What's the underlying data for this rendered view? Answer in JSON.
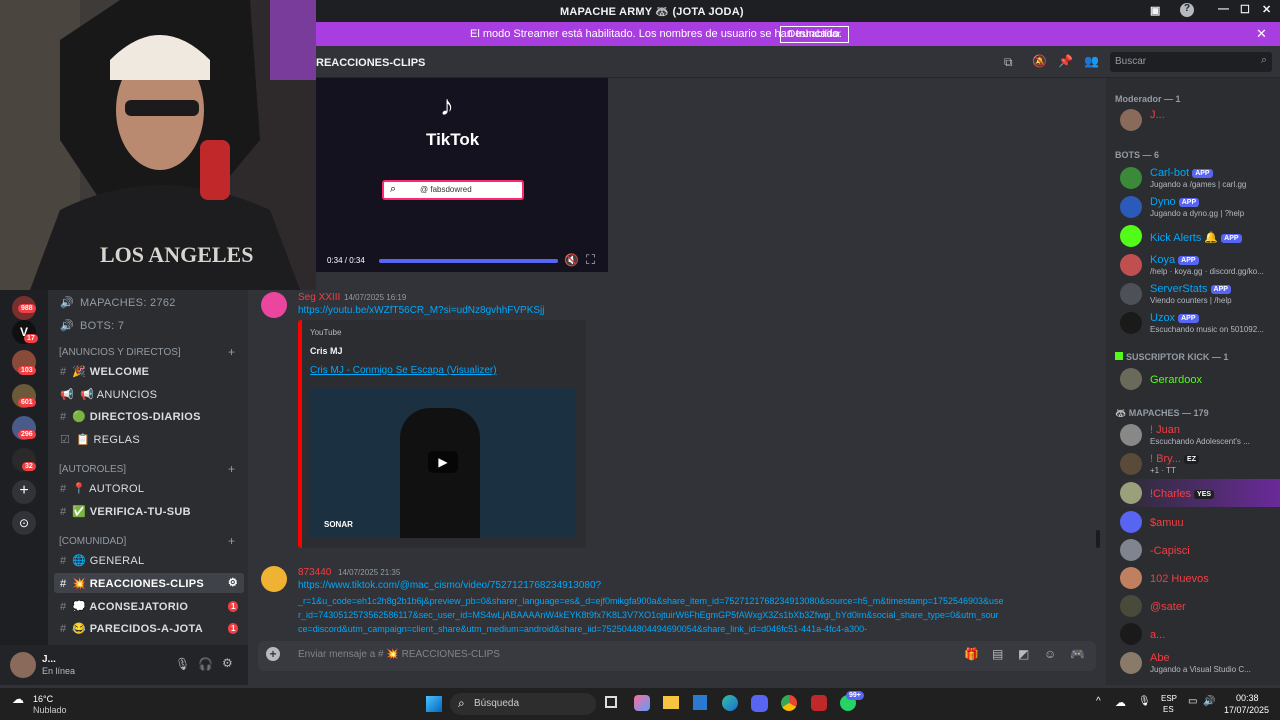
{
  "window": {
    "title": "MAPACHE ARMY 🦝 (JOTA JODA)"
  },
  "streamer_banner": {
    "message": "El modo Streamer está habilitado. Los nombres de usuario se han truncado.",
    "disable_label": "Deshabilitar"
  },
  "channel_header": {
    "name": "REACCIONES-CLIPS",
    "search_placeholder": "Buscar"
  },
  "tiktok_video": {
    "brand": "TikTok",
    "handle": "@ fabsdowred",
    "time": "0:34 / 0:34",
    "progress": 1.0
  },
  "server_rail": {
    "badges": [
      "988",
      "17",
      "103",
      "601",
      "296",
      "32"
    ]
  },
  "channels": {
    "stats": [
      "MAPACHES: 2762",
      "BOTS: 7"
    ],
    "categories": [
      "[ANUNCIOS Y DIRECTOS]",
      "[AUTOROLES]",
      "[COMUNIDAD]"
    ],
    "items": [
      {
        "label": "🎉 WELCOME"
      },
      {
        "label": "📢 ANUNCIOS"
      },
      {
        "label": "🟢 DIRECTOS-DIARIOS"
      },
      {
        "label": "📋 REGLAS"
      },
      {
        "label": "📍 AUTOROL"
      },
      {
        "label": "✅ VERIFICA-TU-SUB"
      },
      {
        "label": "🌐 GENERAL"
      },
      {
        "label": "💥 REACCIONES-CLIPS"
      },
      {
        "label": "💭 ACONSEJATORIO",
        "badge": "1"
      },
      {
        "label": "😂 PARECIDOS-A-JOTA",
        "badge": "1"
      }
    ]
  },
  "user_panel": {
    "name": "J...",
    "status": "En línea"
  },
  "messages": [
    {
      "author": "Seg XXIII",
      "time": "14/07/2025 16:19",
      "link": "https://youtu.be/xWZfT56CR_M?si=udNz8gvhhFVPKSjj",
      "embed": {
        "provider": "YouTube",
        "author": "Cris MJ",
        "title": "Cris MJ - Conmigo Se Escapa (Visualizer)",
        "thumb_label": "SONAR"
      }
    },
    {
      "author": "873440",
      "time": "14/07/2025 21:35",
      "link_lines": [
        "https://www.tiktok.com/@mac_cismo/video/7527121768234913080?",
        "_r=1&u_code=eh1c2h8g2b1b6j&preview_pb=0&sharer_language=es&_d=ejf0mikgfa900a&share_item_id=7527121768234913080&source=h5_m&timestamp=1752546903&use",
        "r_id=7430512573562586117&sec_user_id=MS4wLjABAAAAnW4kEYK8t9fx7K8L3V7XO1ojtuirW6FhEgmGP5fAWxgX3Zs1bXb3Zfwgi_bYd0im&social_share_type=0&utm_sour",
        "ce=discord&utm_campaign=client_share&utm_medium=android&share_iid=7525044804494690054&share_link_id=d046fc51-441a-4fc4-a300-"
      ]
    }
  ],
  "composer": {
    "placeholder": "Enviar mensaje a # 💥 REACCIONES-CLIPS"
  },
  "members": {
    "sections": [
      {
        "title": "Moderador — 1",
        "list": [
          {
            "name": "J...",
            "status": ""
          }
        ]
      },
      {
        "title": "BOTS — 6",
        "list": [
          {
            "name": "Carl-bot",
            "status": "Jugando a /games | carl.gg",
            "app": "APP"
          },
          {
            "name": "Dyno",
            "status": "Jugando a dyno.gg | ?help",
            "app": "APP"
          },
          {
            "name": "Kick Alerts",
            "status": "",
            "app": "APP"
          },
          {
            "name": "Koya",
            "status": "/help · koya.gg · discord.gg/ko...",
            "app": "APP"
          },
          {
            "name": "ServerStats",
            "status": "Viendo counters | /help",
            "app": "APP"
          },
          {
            "name": "Uzox",
            "status": "Escuchando music on 501092...",
            "app": "APP"
          }
        ]
      },
      {
        "title": "SUSCRIPTOR KICK — 1",
        "list": [
          {
            "name": "Gerardoox",
            "status": ""
          }
        ]
      },
      {
        "title": "MAPACHES — 179",
        "list": [
          {
            "name": "! Juan",
            "status": "Escuchando Adolescent's ..."
          },
          {
            "name": "! Bry...",
            "status": "+1 · TT",
            "tag": "EZ"
          },
          {
            "name": "!Charles",
            "status": "",
            "tag": "YES"
          },
          {
            "name": "$amuu",
            "status": ""
          },
          {
            "name": "-Capisci",
            "status": ""
          },
          {
            "name": "102 Huevos",
            "status": ""
          },
          {
            "name": "@sater",
            "status": ""
          },
          {
            "name": "a...",
            "status": ""
          },
          {
            "name": "Abe",
            "status": "Jugando a Visual Studio C..."
          }
        ]
      }
    ]
  },
  "taskbar": {
    "weather_temp": "16°C",
    "weather_desc": "Nublado",
    "search_label": "Búsqueda",
    "lang1": "ESP",
    "lang2": "ES",
    "time": "00:38",
    "date": "17/07/2025",
    "notif_badge": "99+"
  },
  "colors": {
    "blurple": "#5865f2",
    "streamer_purple": "#a93ee0",
    "link": "#00a8fc",
    "red": "#f23f43"
  }
}
